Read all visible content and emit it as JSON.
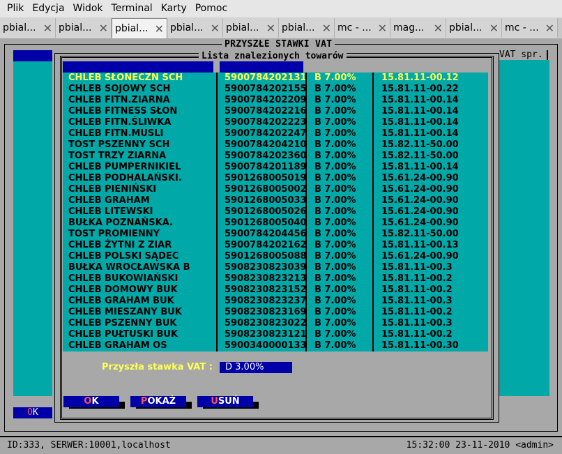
{
  "menu": [
    "Plik",
    "Edycja",
    "Widok",
    "Terminal",
    "Karty",
    "Pomoc"
  ],
  "tabs": [
    {
      "label": "pbial...",
      "active": false
    },
    {
      "label": "pbial...",
      "active": false
    },
    {
      "label": "pbial...",
      "active": true
    },
    {
      "label": "pbial...",
      "active": false
    },
    {
      "label": "pbial...",
      "active": false
    },
    {
      "label": "pbial...",
      "active": false
    },
    {
      "label": "mc - ...",
      "active": false
    },
    {
      "label": "mag...",
      "active": false
    },
    {
      "label": "pbial...",
      "active": false
    },
    {
      "label": "mc - ...",
      "active": false
    }
  ],
  "outer_title": "PRZYSZŁE STAWKI VAT",
  "right_header": "VAT spr.",
  "left_ok": {
    "hot": "O",
    "rest": "K"
  },
  "dialog_title": "Lista znalezionych towarów",
  "rows": [
    {
      "name": "CHLEB SŁONECZN SCH",
      "ean": "5900784202131",
      "vat": "B 7.00%",
      "code": "15.81.11-00.12",
      "selected": true
    },
    {
      "name": "CHLEB SOJOWY SCH",
      "ean": "5900784202155",
      "vat": "B 7.00%",
      "code": "15.81.11-00.22"
    },
    {
      "name": "CHLEB FITN.ZIARNA",
      "ean": "5900784202209",
      "vat": "B 7.00%",
      "code": "15.81.11-00.14"
    },
    {
      "name": "CHLEB FITNESS SŁON",
      "ean": "5900784202216",
      "vat": "B 7.00%",
      "code": "15.81.11-00.14"
    },
    {
      "name": "CHLEB FITN.ŚLIWKA",
      "ean": "5900784202223",
      "vat": "B 7.00%",
      "code": "15.81.11-00.14"
    },
    {
      "name": "CHLEB FITN.MUSLI",
      "ean": "5900784202247",
      "vat": "B 7.00%",
      "code": "15.81.11-00.14"
    },
    {
      "name": "TOST PSZENNY SCH",
      "ean": "5900784204210",
      "vat": "B 7.00%",
      "code": "15.82.11-50.00"
    },
    {
      "name": "TOST TRZY ZIARNA",
      "ean": "5900784202360",
      "vat": "B 7.00%",
      "code": "15.82.11-50.00"
    },
    {
      "name": "CHLEB PUMPERNIKIEL",
      "ean": "5900784201189",
      "vat": "B 7.00%",
      "code": "15.81.11-00.14"
    },
    {
      "name": "CHLEB PODHALAŃSKI.",
      "ean": "5901268005019",
      "vat": "B 7.00%",
      "code": "15.61.24-00.90"
    },
    {
      "name": "CHLEB PIENIŃSKI",
      "ean": "5901268005002",
      "vat": "B 7.00%",
      "code": "15.61.24-00.90"
    },
    {
      "name": "CHLEB GRAHAM",
      "ean": "5901268005033",
      "vat": "B 7.00%",
      "code": "15.61.24-00.90"
    },
    {
      "name": "CHLEB LITEWSKI",
      "ean": "5901268005026",
      "vat": "B 7.00%",
      "code": "15.61.24-00.90"
    },
    {
      "name": "BUŁKA POZNAŃSKA.",
      "ean": "5901268005040",
      "vat": "B 7.00%",
      "code": "15.61.24-00.90"
    },
    {
      "name": "TOST PROMIENNY",
      "ean": "5900784204456",
      "vat": "B 7.00%",
      "code": "15.82.11-50.00"
    },
    {
      "name": "CHLEB ŻYTNI Z ZIAR",
      "ean": "5900784202162",
      "vat": "B 7.00%",
      "code": "15.81.11-00.13"
    },
    {
      "name": "CHLEB POLSKI SĄDEC",
      "ean": "5901268005088",
      "vat": "B 7.00%",
      "code": "15.61.24-00.90"
    },
    {
      "name": "BUŁKA WROCŁAWSKA B",
      "ean": "5908230823039",
      "vat": "B 7.00%",
      "code": "15.81.11-00.3"
    },
    {
      "name": "CHLEB BUKOWIAŃSKI",
      "ean": "5908230823213",
      "vat": "B 7.00%",
      "code": "15.81.11-00.2"
    },
    {
      "name": "CHLEB DOMOWY BUK",
      "ean": "5908230823152",
      "vat": "B 7.00%",
      "code": "15.81.11-00.2"
    },
    {
      "name": "CHLEB GRAHAM BUK",
      "ean": "5908230823237",
      "vat": "B 7.00%",
      "code": "15.81.11-00.3"
    },
    {
      "name": "CHLEB MIESZANY BUK",
      "ean": "5908230823169",
      "vat": "B 7.00%",
      "code": "15.81.11-00.2"
    },
    {
      "name": "CHLEB PSZENNY BUK",
      "ean": "5908230823022",
      "vat": "B 7.00%",
      "code": "15.81.11-00.3"
    },
    {
      "name": "CHLEB PUŁTUSKI BUK",
      "ean": "5908230823121",
      "vat": "B 7.00%",
      "code": "15.81.11-00.2"
    },
    {
      "name": "CHLEB GRAHAM OS",
      "ean": "5900340000133",
      "vat": "B 7.00%",
      "code": "15.81.11-00.30"
    }
  ],
  "future_vat": {
    "label": "Przyszła stawka VAT :",
    "value": "D 3.00%"
  },
  "buttons": {
    "ok": {
      "hot": "O",
      "rest": "K"
    },
    "show": {
      "hot": "P",
      "rest": "OKAŻ"
    },
    "delete": {
      "hot": "U",
      "rest": "SUŃ"
    }
  },
  "status": {
    "left": "ID:333, SERWER:10001,localhost",
    "right": "15:32:00 23-11-2010 <admin>"
  },
  "colors": {
    "terminal_bg": "#a8a8a8",
    "cyan": "#00a8a8",
    "blue": "#0000a8",
    "yellow": "#ffff55",
    "hotkey_red": "#ff5555"
  }
}
